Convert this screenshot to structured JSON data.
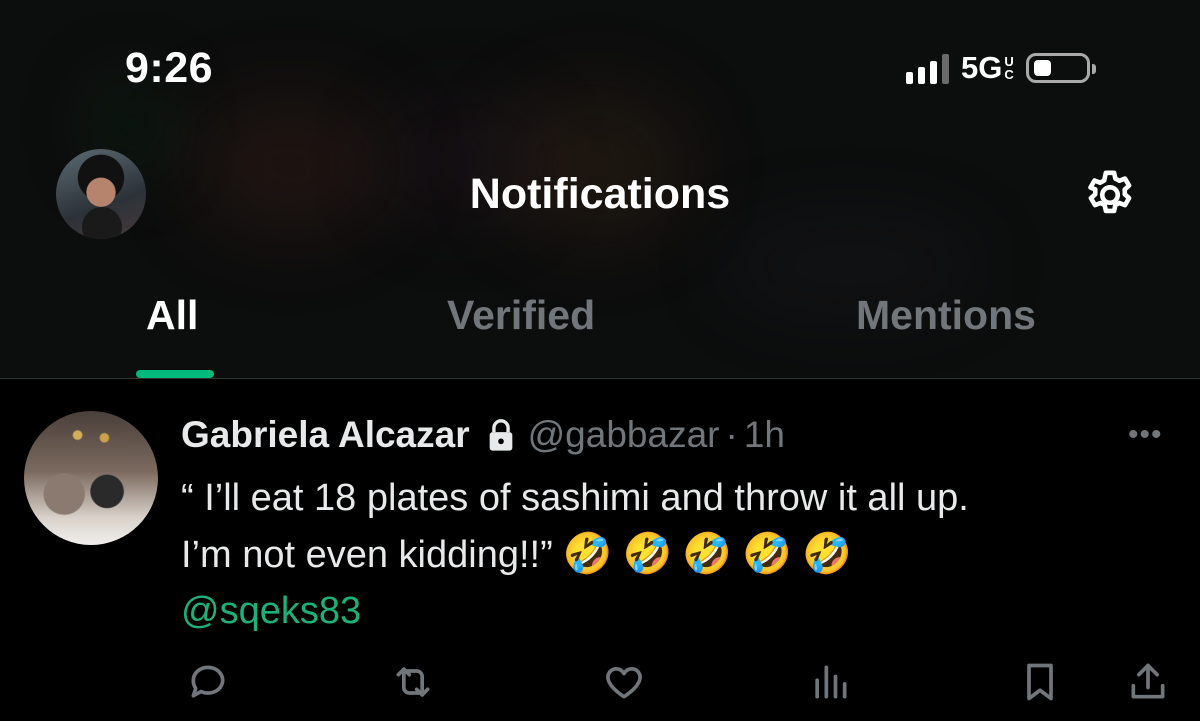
{
  "status_bar": {
    "time": "9:26",
    "network": "5G",
    "network_suffix_top": "U",
    "network_suffix_bottom": "C"
  },
  "header": {
    "title": "Notifications",
    "settings_icon": "gear-icon",
    "avatar_icon": "profile-avatar"
  },
  "tabs": [
    {
      "label": "All",
      "active": true
    },
    {
      "label": "Verified",
      "active": false
    },
    {
      "label": "Mentions",
      "active": false
    }
  ],
  "post": {
    "author_name": "Gabriela Alcazar",
    "protected_icon": "lock-icon",
    "handle": "@gabbazar",
    "separator": "·",
    "age": "1h",
    "more_label": "•••",
    "text_line1": "“ I’ll eat 18 plates of sashimi and throw it all up.",
    "text_line2": "I’m not even kidding!!”",
    "emojis": [
      "🤣",
      "🤣",
      "🤣",
      "🤣",
      "🤣"
    ],
    "mention": "@sqeks83",
    "actions": [
      "reply-icon",
      "repost-icon",
      "like-icon",
      "views-icon",
      "bookmark-icon",
      "share-icon"
    ]
  },
  "colors": {
    "accent": "#00ba7c",
    "mention": "#1db179",
    "muted": "#71767b",
    "text": "#e7e9ea",
    "background": "#000000"
  }
}
